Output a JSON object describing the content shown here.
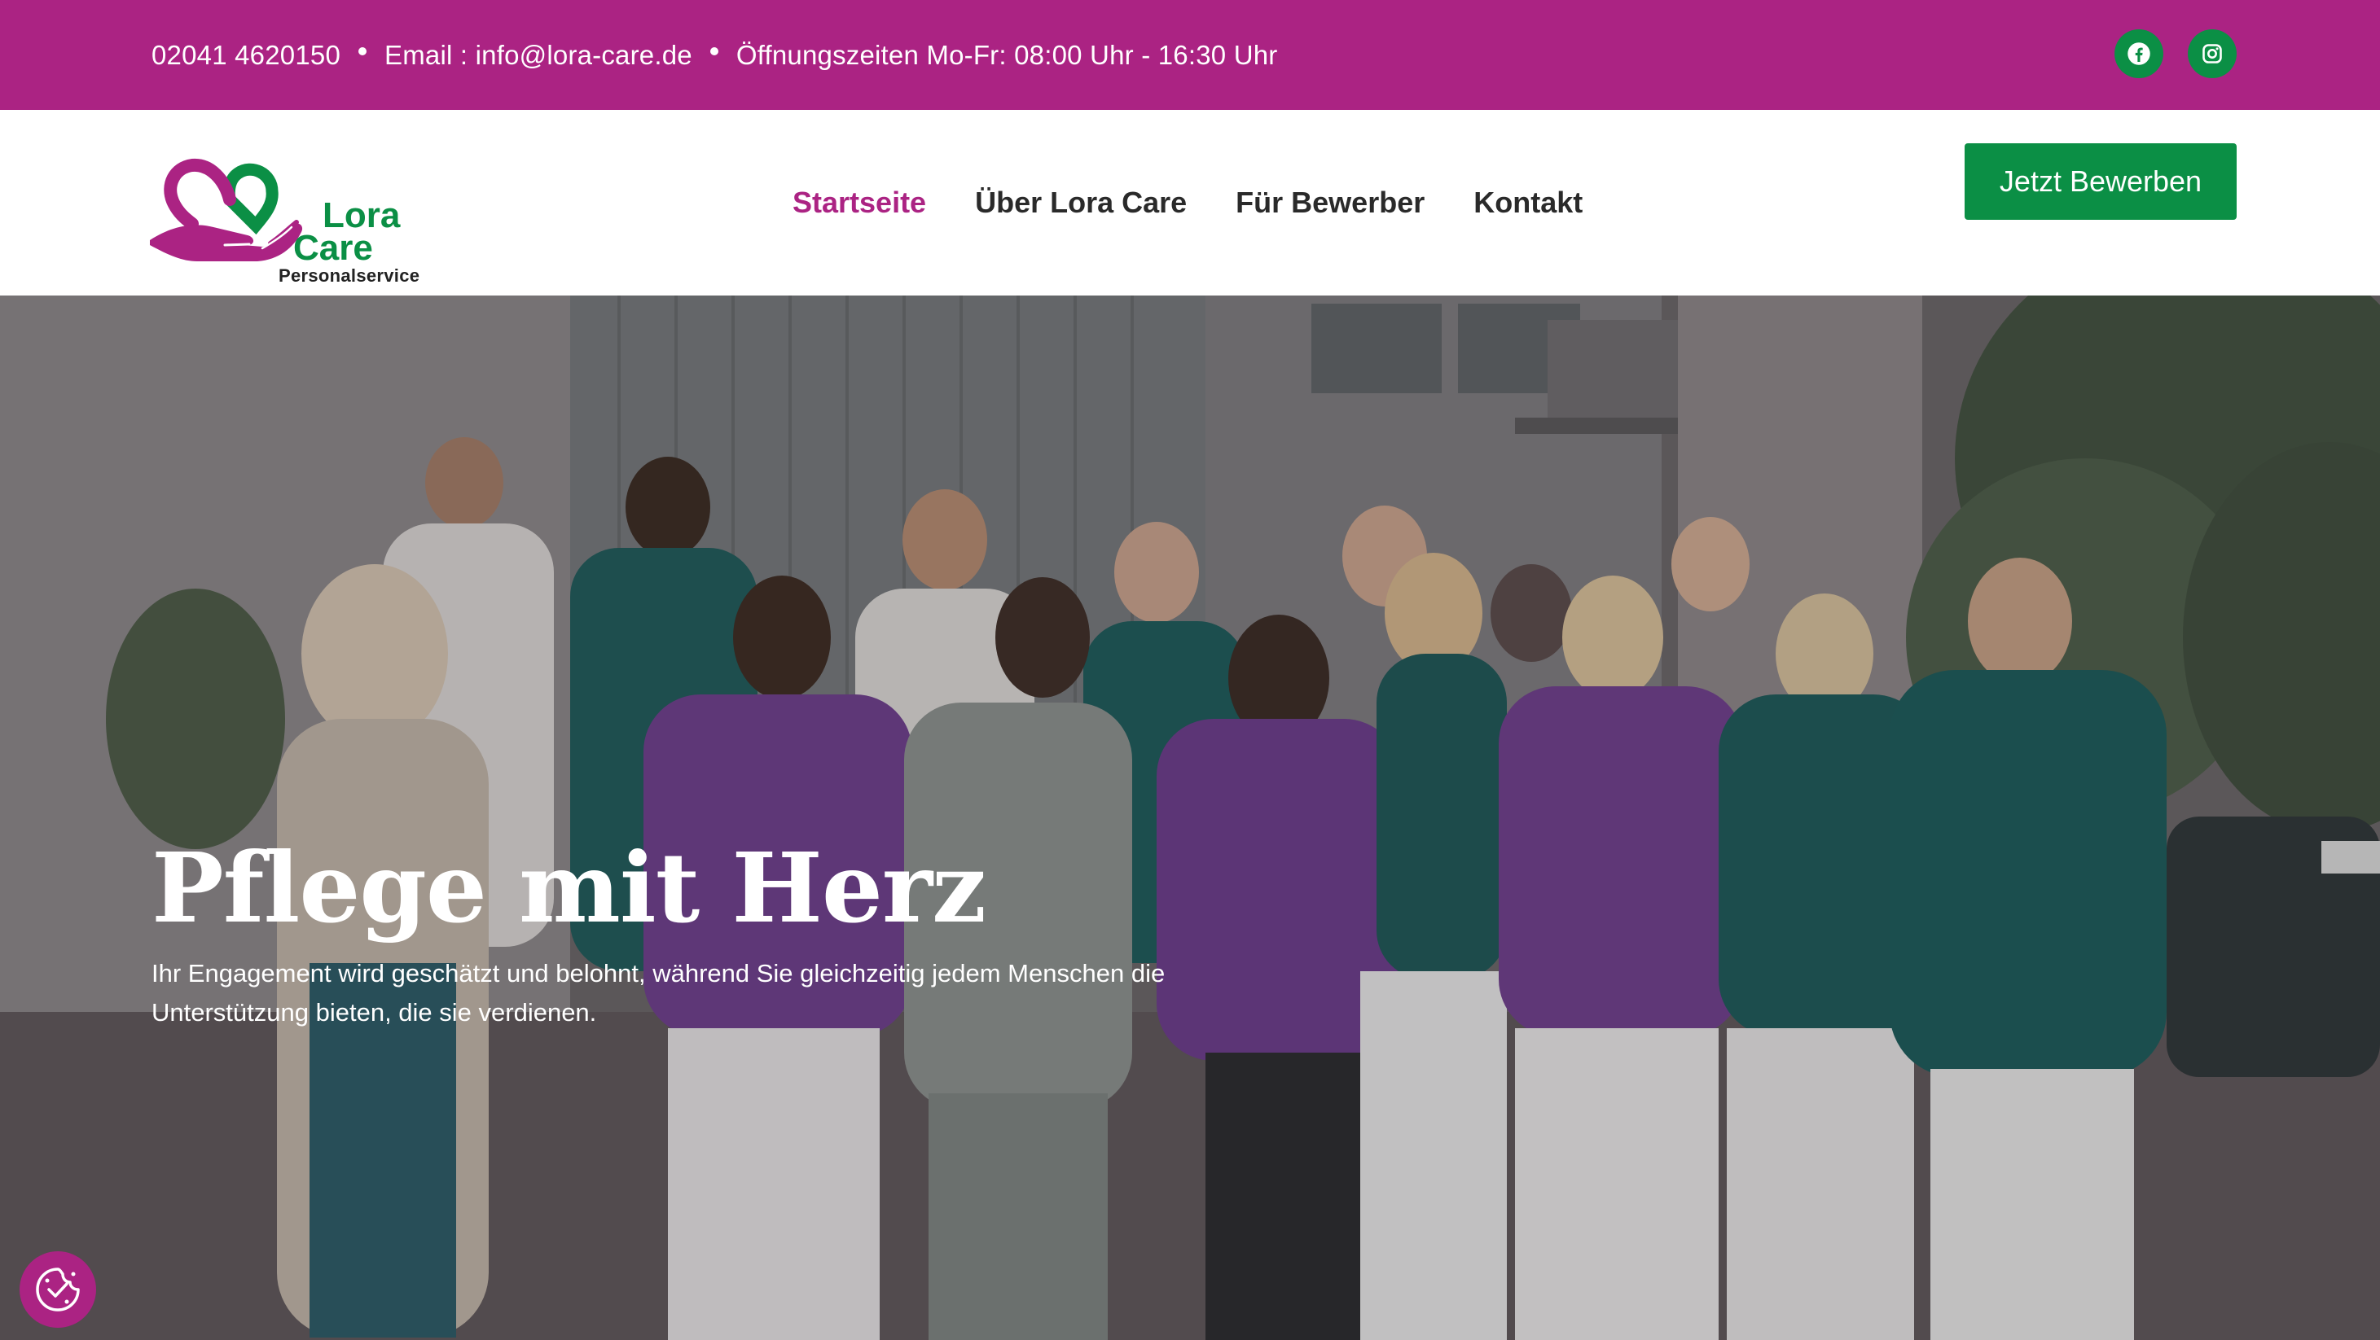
{
  "topbar": {
    "phone": "02041 4620150",
    "email": "Email : info@lora-care.de",
    "hours": "Öffnungszeiten Mo-Fr: 08:00 Uhr - 16:30 Uhr",
    "social": [
      {
        "icon": "facebook-icon"
      },
      {
        "icon": "instagram-icon"
      }
    ]
  },
  "logo": {
    "line1": "Lora",
    "line2": "Care",
    "line3": "Personalservice"
  },
  "nav": {
    "items": [
      {
        "label": "Startseite",
        "active": true
      },
      {
        "label": "Über Lora Care",
        "active": false
      },
      {
        "label": "Für Bewerber",
        "active": false
      },
      {
        "label": "Kontakt",
        "active": false
      }
    ]
  },
  "cta": {
    "label": "Jetzt Bewerben"
  },
  "hero": {
    "title": "Pflege mit Herz",
    "text": "Ihr Engagement wird geschätzt und belohnt, während Sie gleichzeitig jedem Menschen die Unterstützung bieten, die sie verdienen."
  },
  "consent": {
    "icon": "cookie-consent-icon"
  },
  "colors": {
    "brand_magenta": "#ab2383",
    "brand_green": "#0b8f45",
    "nav_text": "#2a2a2a"
  }
}
